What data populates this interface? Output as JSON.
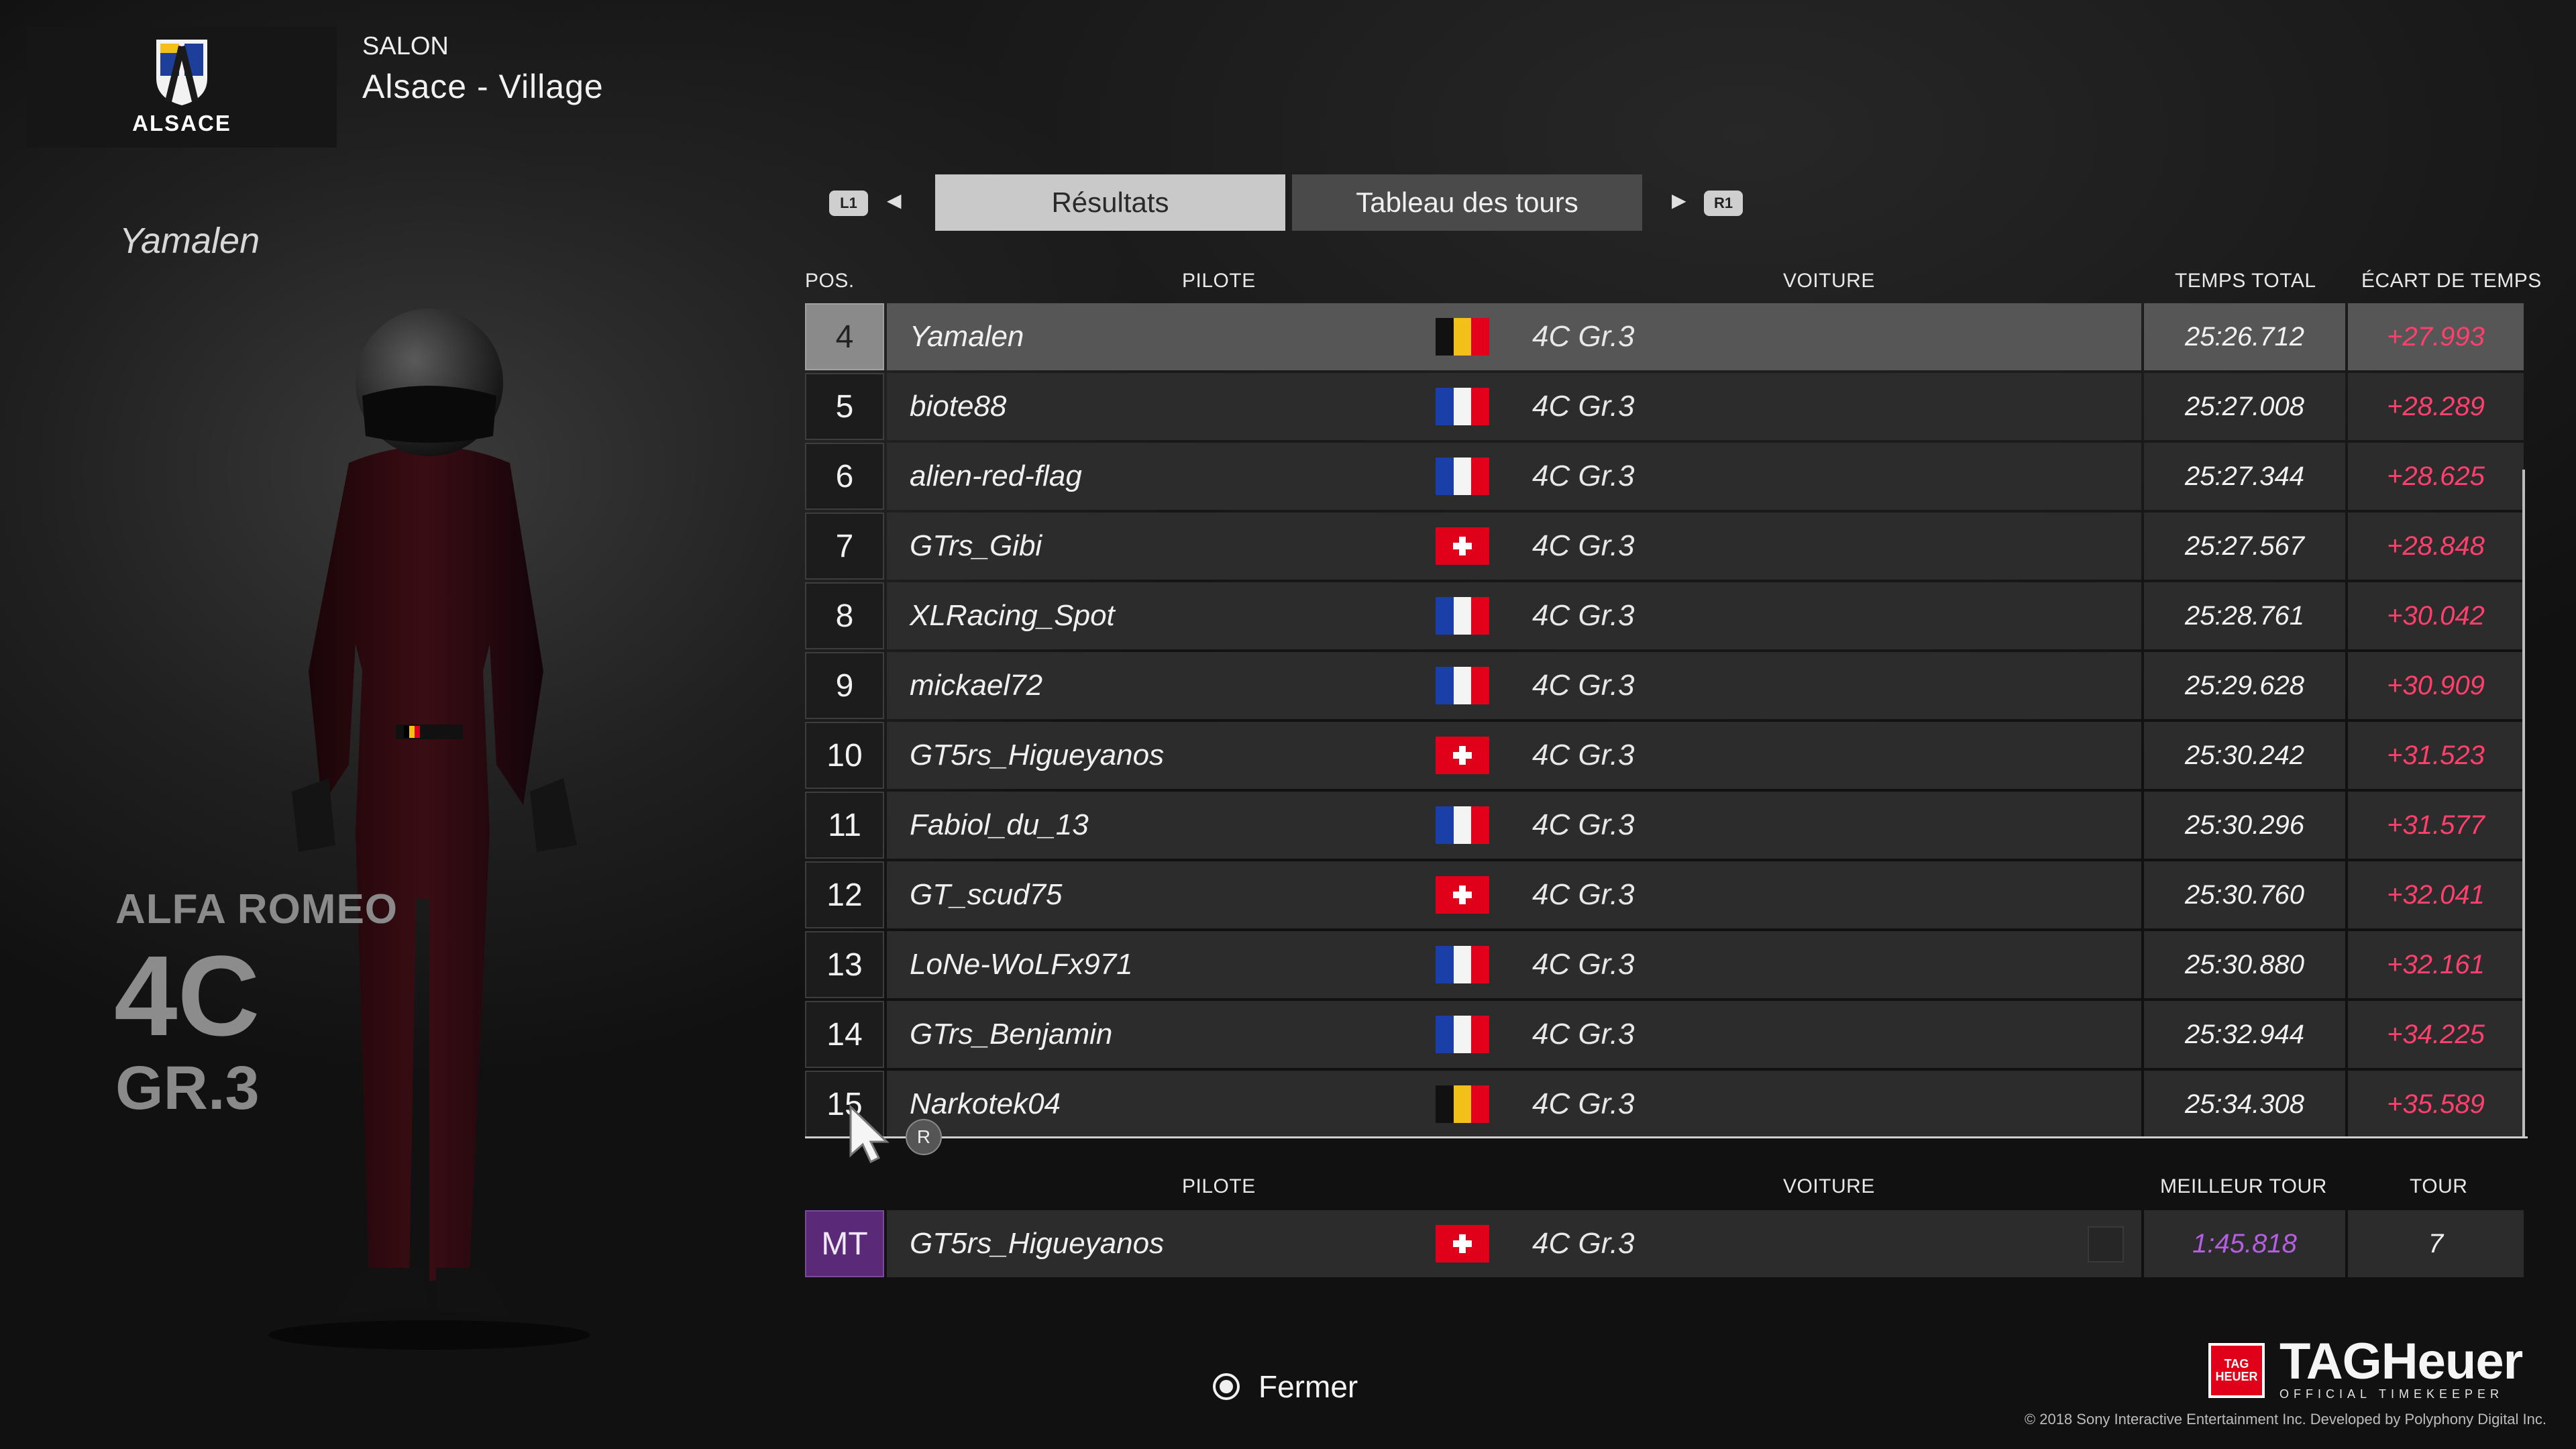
{
  "header": {
    "logo_text": "ALSACE",
    "category": "SALON",
    "event": "Alsace - Village"
  },
  "left_panel": {
    "driver_name": "Yamalen",
    "car_make": "ALFA ROMEO",
    "car_model": "4C",
    "car_class": "GR.3"
  },
  "tabs": {
    "left_shoulder": "L1",
    "right_shoulder": "R1",
    "items": [
      {
        "label": "Résultats",
        "active": true
      },
      {
        "label": "Tableau des tours",
        "active": false
      }
    ]
  },
  "results": {
    "columns": {
      "pos": "POS.",
      "pilot": "PILOTE",
      "car": "VOITURE",
      "total": "TEMPS TOTAL",
      "gap": "ÉCART DE TEMPS"
    },
    "rows": [
      {
        "pos": "4",
        "pilot": "Yamalen",
        "flag": "belgium",
        "car": "4C Gr.3",
        "total": "25:26.712",
        "gap": "+27.993",
        "highlight": true
      },
      {
        "pos": "5",
        "pilot": "biote88",
        "flag": "france",
        "car": "4C Gr.3",
        "total": "25:27.008",
        "gap": "+28.289"
      },
      {
        "pos": "6",
        "pilot": "alien-red-flag",
        "flag": "france",
        "car": "4C Gr.3",
        "total": "25:27.344",
        "gap": "+28.625"
      },
      {
        "pos": "7",
        "pilot": "GTrs_Gibi",
        "flag": "switzerland",
        "car": "4C Gr.3",
        "total": "25:27.567",
        "gap": "+28.848"
      },
      {
        "pos": "8",
        "pilot": "XLRacing_Spot",
        "flag": "france",
        "car": "4C Gr.3",
        "total": "25:28.761",
        "gap": "+30.042"
      },
      {
        "pos": "9",
        "pilot": "mickael72",
        "flag": "france",
        "car": "4C Gr.3",
        "total": "25:29.628",
        "gap": "+30.909"
      },
      {
        "pos": "10",
        "pilot": "GT5rs_Higueyanos",
        "flag": "switzerland",
        "car": "4C Gr.3",
        "total": "25:30.242",
        "gap": "+31.523"
      },
      {
        "pos": "11",
        "pilot": "Fabiol_du_13",
        "flag": "france",
        "car": "4C Gr.3",
        "total": "25:30.296",
        "gap": "+31.577"
      },
      {
        "pos": "12",
        "pilot": "GT_scud75",
        "flag": "switzerland",
        "car": "4C Gr.3",
        "total": "25:30.760",
        "gap": "+32.041"
      },
      {
        "pos": "13",
        "pilot": "LoNe-WoLFx971",
        "flag": "france",
        "car": "4C Gr.3",
        "total": "25:30.880",
        "gap": "+32.161"
      },
      {
        "pos": "14",
        "pilot": "GTrs_Benjamin",
        "flag": "france",
        "car": "4C Gr.3",
        "total": "25:32.944",
        "gap": "+34.225"
      },
      {
        "pos": "15",
        "pilot": "Narkotek04",
        "flag": "belgium",
        "car": "4C Gr.3",
        "total": "25:34.308",
        "gap": "+35.589"
      }
    ]
  },
  "fastest_lap": {
    "columns": {
      "pilot": "PILOTE",
      "car": "VOITURE",
      "best": "MEILLEUR TOUR",
      "lap": "TOUR"
    },
    "badge": "MT",
    "pilot": "GT5rs_Higueyanos",
    "flag": "switzerland",
    "car": "4C Gr.3",
    "best": "1:45.818",
    "lap": "7"
  },
  "cursor_badge": "R",
  "footer": {
    "close_label": "Fermer",
    "sponsor_shield_top": "TAG",
    "sponsor_shield_bottom": "HEUER",
    "sponsor_name": "TAGHeuer",
    "sponsor_sub": "OFFICIAL TIMEKEEPER",
    "copyright": "© 2018 Sony Interactive Entertainment Inc. Developed by Polyphony Digital Inc."
  },
  "colors": {
    "gap": "#ff3f6c",
    "fastest": "#b35fe0",
    "mt_badge": "#5a2a78",
    "tab_active": "#c9c9c9"
  }
}
